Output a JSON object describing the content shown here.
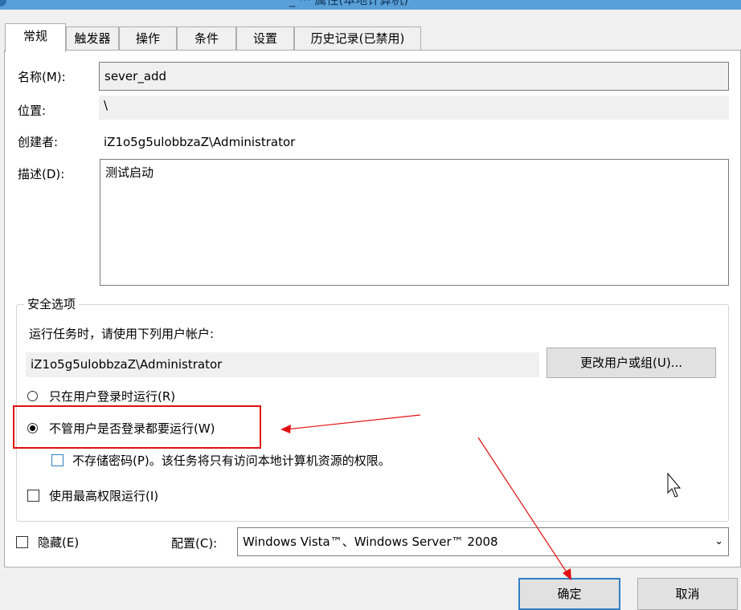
{
  "window": {
    "title_fragment": "_ ··· 属性(本地计算机)"
  },
  "tabs": [
    {
      "label": "常规"
    },
    {
      "label": "触发器"
    },
    {
      "label": "操作"
    },
    {
      "label": "条件"
    },
    {
      "label": "设置"
    },
    {
      "label": "历史记录(已禁用)"
    }
  ],
  "general": {
    "name_label": "名称(M):",
    "name_value": "sever_add",
    "location_label": "位置:",
    "location_value": "\\",
    "author_label": "创建者:",
    "author_value": "iZ1o5g5ulobbzaZ\\Administrator",
    "description_label": "描述(D):",
    "description_value": "测试启动"
  },
  "security": {
    "group_title": "安全选项",
    "run_as_prompt": "运行任务时，请使用下列用户帐户:",
    "account": "iZ1o5g5ulobbzaZ\\Administrator",
    "change_user_button": "更改用户或组(U)...",
    "radio_logged_on": "只在用户登录时运行(R)",
    "radio_whether_logged_on": "不管用户是否登录都要运行(W)",
    "selected_option": "radio_whether_logged_on",
    "no_store_password": "不存储密码(P)。该任务将只有访问本地计算机资源的权限。",
    "highest_privileges": "使用最高权限运行(I)"
  },
  "bottom": {
    "hidden_label": "隐藏(E)",
    "configure_label": "配置(C):",
    "configure_value": "Windows Vista™、Windows Server™ 2008",
    "ok_button": "确定",
    "cancel_button": "取消"
  },
  "annotation_color": "#e01010",
  "accent_color": "#2f7fc5"
}
